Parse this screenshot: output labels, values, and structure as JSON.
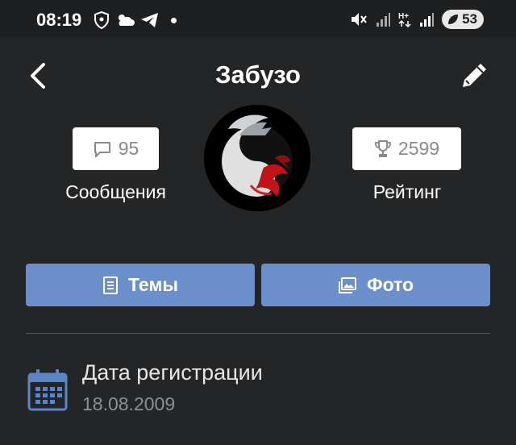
{
  "status_bar": {
    "time": "08:19",
    "battery": "53",
    "left_icons": [
      "vpn-shield-icon",
      "weather-icon",
      "telegram-icon",
      "notification-dot"
    ],
    "right_icons": [
      "mute-icon",
      "signal-icon",
      "network-h-plus-icon",
      "signal-icon",
      "battery-icon"
    ]
  },
  "header": {
    "title": "Забузо",
    "back_icon": "chevron-left-icon",
    "edit_icon": "pencil-icon"
  },
  "profile": {
    "messages_count": "95",
    "messages_label": "Сообщения",
    "rating_value": "2599",
    "rating_label": "Рейтинг",
    "avatar": "yin-yang-dragon-avatar"
  },
  "actions": {
    "themes_label": "Темы",
    "photo_label": "Фото"
  },
  "registration": {
    "label": "Дата регистрации",
    "date": "18.08.2009"
  },
  "colors": {
    "background": "#242526",
    "status_bar": "#1e1f20",
    "button": "#6a8fcb",
    "calendar_icon": "#5a86c4"
  }
}
